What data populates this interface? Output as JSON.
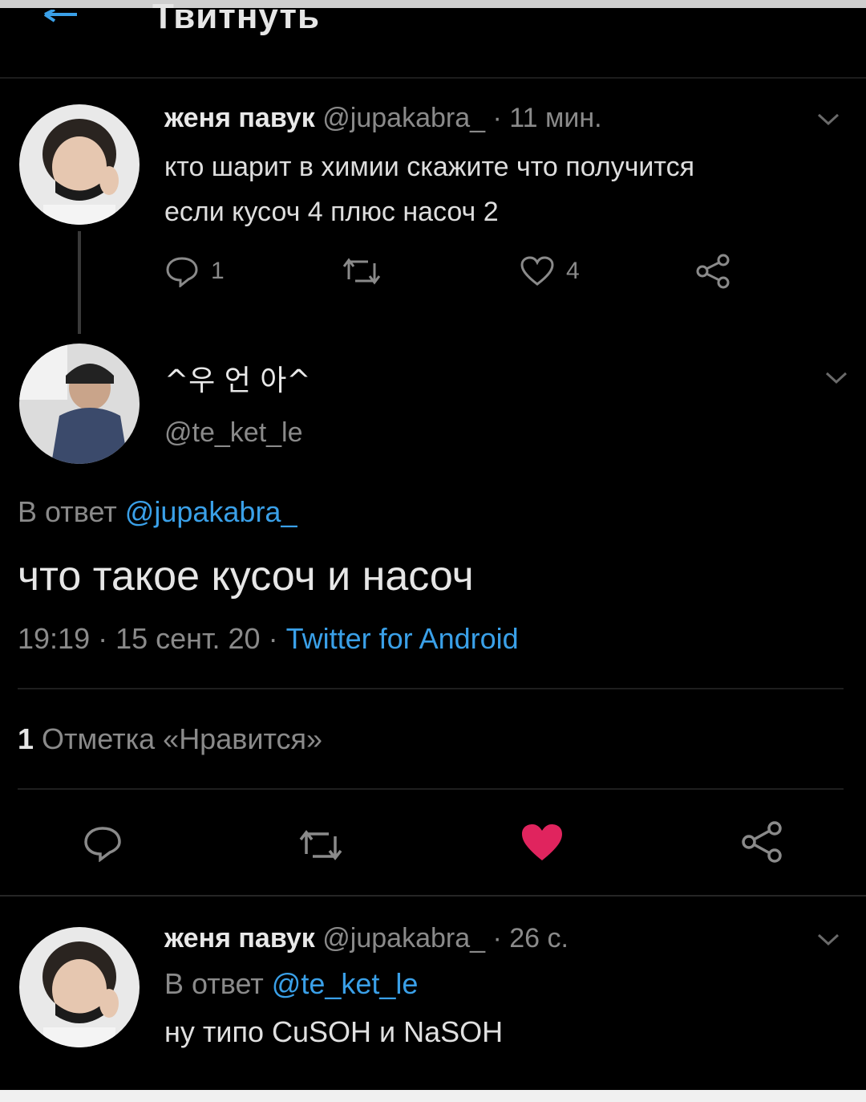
{
  "header": {
    "title": "Твитнуть"
  },
  "tweet1": {
    "name": "женя павук",
    "handle": "@jupakabra_",
    "time": "· 11 мин.",
    "text_line1": "кто шарит в химии скажите что получится",
    "text_line2": "если кусоч 4 плюс насоч 2",
    "reply_count": "1",
    "like_count": "4"
  },
  "tweet2": {
    "name": "^우 언 아^",
    "handle": "@te_ket_le",
    "reply_prefix": "В ответ",
    "reply_to": "@jupakabra_",
    "text": "что такое кусоч и насоч",
    "time_date": "19:19 · 15 сент. 20 ·",
    "source": "Twitter for Android",
    "likes_number": "1",
    "likes_label": "Отметка «Нравится»"
  },
  "tweet3": {
    "name": "женя павук",
    "handle": "@jupakabra_",
    "time": "· 26 с.",
    "reply_prefix": "В ответ",
    "reply_to": "@te_ket_le",
    "text": "ну типо CuSOH и NaSOH"
  },
  "colors": {
    "background": "#000000",
    "link": "#3aa0e8",
    "like_active": "#e0245e",
    "muted": "#8a8a8a"
  }
}
